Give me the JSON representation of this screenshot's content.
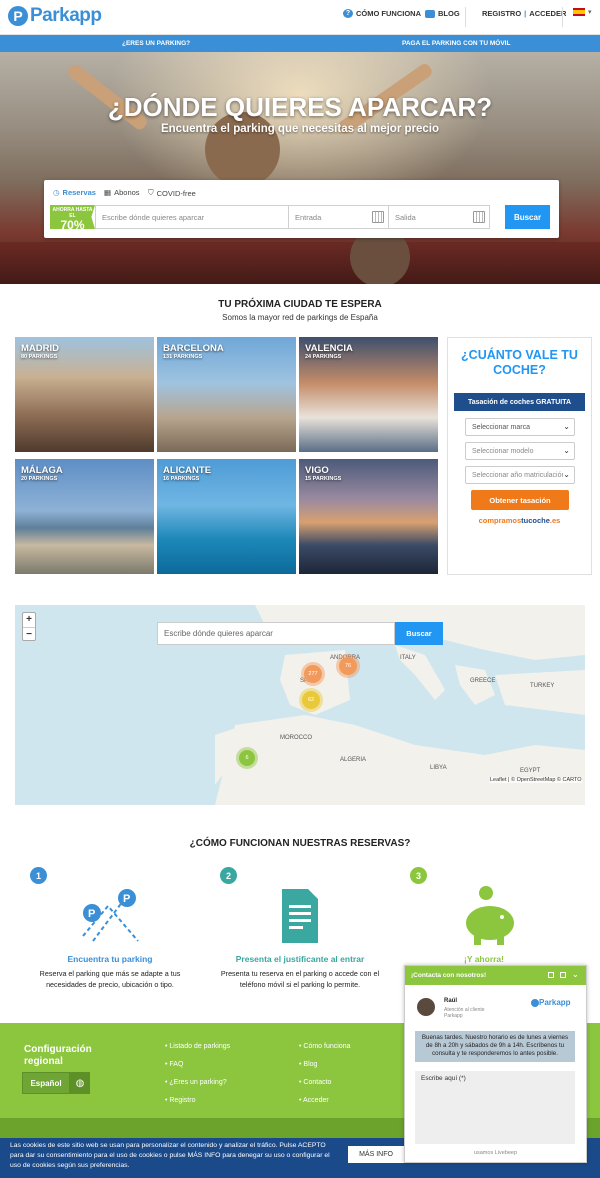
{
  "header": {
    "logo": "Parkapp",
    "nav": [
      "CÓMO FUNCIONA",
      "BLOG"
    ],
    "register": "REGISTRO",
    "login": "ACCEDER",
    "divider": "|"
  },
  "bluebar": {
    "left": "¿ERES UN PARKING?",
    "right": "PAGA EL PARKING CON TU MÓVIL"
  },
  "hero": {
    "title": "¿DÓNDE QUIERES APARCAR?",
    "subtitle": "Encuentra el parking que necesitas al mejor precio"
  },
  "search": {
    "tabs": [
      "Reservas",
      "Abonos",
      "COVID-free"
    ],
    "ribbon_small": "AHORRA HASTA EL",
    "ribbon_big": "70%",
    "placeholder": "Escribe dónde quieres aparcar",
    "entry": "Entrada",
    "exit": "Salida",
    "button": "Buscar"
  },
  "cities_section": {
    "title": "TU PRÓXIMA CIUDAD TE ESPERA",
    "subtitle": "Somos la mayor red de parkings de España"
  },
  "cities": [
    {
      "name": "MADRID",
      "count": "80 PARKINGS"
    },
    {
      "name": "BARCELONA",
      "count": "131 PARKINGS"
    },
    {
      "name": "VALENCIA",
      "count": "24 PARKINGS"
    },
    {
      "name": "MÁLAGA",
      "count": "20 PARKINGS"
    },
    {
      "name": "ALICANTE",
      "count": "16 PARKINGS"
    },
    {
      "name": "VIGO",
      "count": "15 PARKINGS"
    }
  ],
  "car_value": {
    "title": "¿CUÁNTO VALE TU COCHE?",
    "subtitle": "Tasación de coches GRATUITA",
    "selects": [
      "Seleccionar marca",
      "Seleccionar modelo",
      "Seleccionar año matriculación"
    ],
    "button": "Obtener tasación",
    "brand_a": "compramos",
    "brand_b": "tucoche",
    "brand_c": ".es"
  },
  "map": {
    "zoom_in": "+",
    "zoom_out": "−",
    "placeholder": "Escribe dónde quieres aparcar",
    "button": "Buscar",
    "labels": [
      "ANDORRA",
      "SPAIN",
      "ITALY",
      "GREECE",
      "TURKEY",
      "MOROCCO",
      "ALGERIA",
      "LIBYA",
      "EGYPT"
    ],
    "clusters": [
      "277",
      "76",
      "62",
      "6"
    ],
    "attribution": "Leaflet | © OpenStreetMap © CARTO"
  },
  "how": {
    "title": "¿CÓMO FUNCIONAN NUESTRAS RESERVAS?",
    "steps": [
      {
        "num": "1",
        "title": "Encuentra tu parking",
        "desc": "Reserva el parking que más se adapte a tus necesidades de precio, ubicación o tipo."
      },
      {
        "num": "2",
        "title": "Presenta el justificante al entrar",
        "desc": "Presenta tu reserva en el parking o accede con el teléfono móvil si el parking lo permite."
      },
      {
        "num": "3",
        "title": "¡Y ahorra!",
        "desc": ""
      }
    ]
  },
  "footer": {
    "config": "Configuración regional",
    "language": "Español",
    "col1": [
      "Listado de parkings",
      "FAQ",
      "¿Eres un parking?",
      "Registro"
    ],
    "col2": [
      "Cómo funciona",
      "Blog",
      "Contacto",
      "Acceder"
    ]
  },
  "cookie": {
    "text": "Las cookies de este sitio web se usan para personalizar el contenido y analizar el tráfico. Pulse ACEPTO para dar su consentimiento para el uso de cookies o pulse MÁS INFO para denegar su uso o configurar el uso de cookies según sus preferencias.",
    "more": "MÁS INFO"
  },
  "chat": {
    "header": "¡Contacta con nosotros!",
    "agent": "Raúl",
    "role": "Atención al cliente Parkapp",
    "message": "Buenas tardes. Nuestro horario es de lunes a viernes de 8h a 20h y sábados de 9h a 14h. Escríbenos tu consulta y te responderemos lo antes posible.",
    "input": "Escribe aquí (*)",
    "footer": "usamos Livebeep"
  },
  "colors": {
    "brand_blue": "#3a8fd6",
    "brand_green": "#8cc63f",
    "orange": "#f07a1a",
    "navy": "#1f4e8c"
  }
}
